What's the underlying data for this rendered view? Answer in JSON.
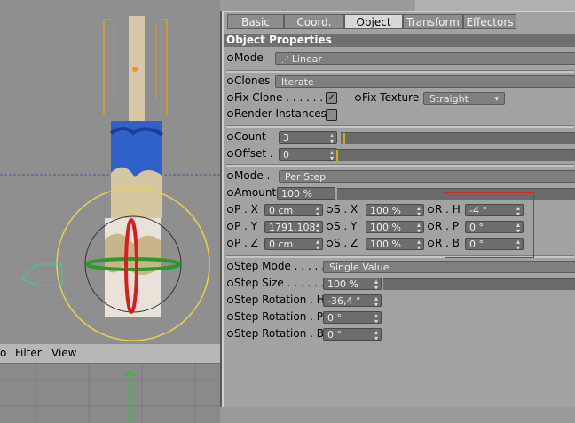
{
  "bottom_menu": {
    "left_cut": "o",
    "filter": "Filter",
    "view": "View"
  },
  "tabs": [
    {
      "label": "Basic",
      "active": false
    },
    {
      "label": "Coord.",
      "active": false
    },
    {
      "label": "Object",
      "active": true
    },
    {
      "label": "Transform",
      "active": false
    },
    {
      "label": "Effectors",
      "active": false
    }
  ],
  "header": "Object Properties",
  "mode": {
    "label": "Mode",
    "value": "Linear"
  },
  "clones": {
    "label": "Clones",
    "value": "Iterate"
  },
  "fix_clone": {
    "label": "Fix Clone",
    "checked": true
  },
  "fix_texture": {
    "label": "Fix Texture",
    "value": "Straight"
  },
  "render_instances": {
    "label": "Render Instances",
    "checked": false
  },
  "count": {
    "label": "Count",
    "value": "3"
  },
  "offset": {
    "label": "Offset",
    "value": "0"
  },
  "step_mode_top": {
    "label": "Mode",
    "value": "Per Step"
  },
  "amount": {
    "label": "Amount",
    "value": "100 %"
  },
  "pos": {
    "px": {
      "label": "P . X",
      "value": "0 cm"
    },
    "py": {
      "label": "P . Y",
      "value": "1791,108"
    },
    "pz": {
      "label": "P . Z",
      "value": "0 cm"
    }
  },
  "scale": {
    "sx": {
      "label": "S . X",
      "value": "100 %"
    },
    "sy": {
      "label": "S . Y",
      "value": "100 %"
    },
    "sz": {
      "label": "S . Z",
      "value": "100 %"
    }
  },
  "rot": {
    "rh": {
      "label": "R . H",
      "value": "-4 °"
    },
    "rp": {
      "label": "R . P",
      "value": "0 °"
    },
    "rb": {
      "label": "R . B",
      "value": "0 °"
    }
  },
  "step_mode": {
    "label": "Step Mode",
    "value": "Single Value"
  },
  "step_size": {
    "label": "Step Size",
    "value": "100 %"
  },
  "step_rot_h": {
    "label": "Step Rotation . H",
    "value": "-36,4 °"
  },
  "step_rot_p": {
    "label": "Step Rotation . P",
    "value": "0 °"
  },
  "step_rot_b": {
    "label": "Step Rotation . B",
    "value": "0 °"
  },
  "colors": {
    "accent": "#e3a21b",
    "highlight": "#e02020",
    "panel": "#a2a2a2"
  }
}
